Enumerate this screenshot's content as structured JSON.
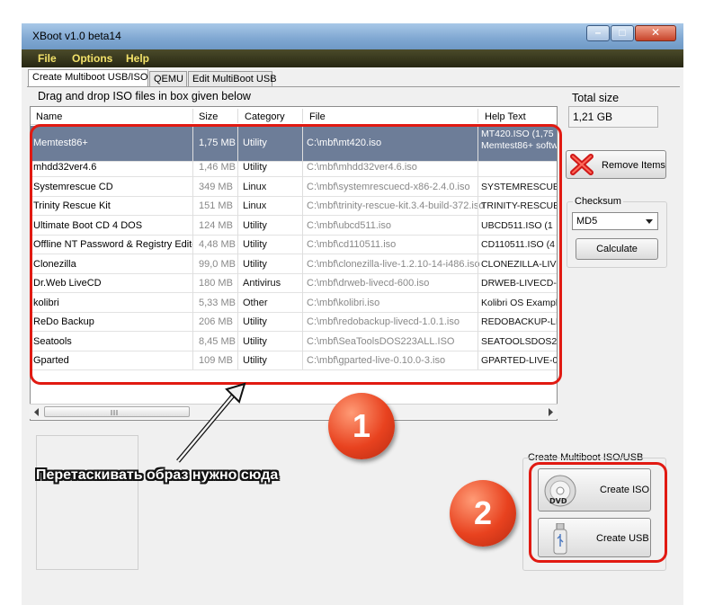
{
  "window": {
    "title": "XBoot v1.0 beta14"
  },
  "menu": [
    "File",
    "Options",
    "Help"
  ],
  "tabs": [
    "Create Multiboot USB/ISO",
    "QEMU",
    "Edit MultiBoot USB"
  ],
  "dragdrop_label": "Drag and drop ISO files in box given below",
  "list": {
    "columns": [
      "Name",
      "Size",
      "Category",
      "File",
      "Help Text"
    ],
    "rows": [
      {
        "name": "Memtest86+",
        "size": "1,75 MB",
        "category": "Utility",
        "file": "C:\\mbf\\mt420.iso",
        "help": "MT420.ISO (1,75",
        "help2": "Memtest86+ softw",
        "selected": true
      },
      {
        "name": "mhdd32ver4.6",
        "size": "1,46 MB",
        "category": "Utility",
        "file": "C:\\mbf\\mhdd32ver4.6.iso",
        "help": ""
      },
      {
        "name": "Systemrescue CD",
        "size": "349 MB",
        "category": "Linux",
        "file": "C:\\mbf\\systemrescuecd-x86-2.4.0.iso",
        "help": "SYSTEMRESCUE"
      },
      {
        "name": "Trinity Rescue Kit",
        "size": "151 MB",
        "category": "Linux",
        "file": "C:\\mbf\\trinity-rescue-kit.3.4-build-372.iso",
        "help": "TRINITY-RESCUE"
      },
      {
        "name": "Ultimate Boot CD 4 DOS",
        "size": "124 MB",
        "category": "Utility",
        "file": "C:\\mbf\\ubcd511.iso",
        "help": "UBCD511.ISO (1"
      },
      {
        "name": "Offline NT Password & Registry Editor",
        "size": "4,48 MB",
        "category": "Utility",
        "file": "C:\\mbf\\cd110511.iso",
        "help": "CD110511.ISO (4"
      },
      {
        "name": "Clonezilla",
        "size": "99,0 MB",
        "category": "Utility",
        "file": "C:\\mbf\\clonezilla-live-1.2.10-14-i486.iso",
        "help": "CLONEZILLA-LIVE"
      },
      {
        "name": "Dr.Web LiveCD",
        "size": "180 MB",
        "category": "Antivirus",
        "file": "C:\\mbf\\drweb-livecd-600.iso",
        "help": "DRWEB-LIVECD-6"
      },
      {
        "name": "kolibri",
        "size": "5,33 MB",
        "category": "Other",
        "file": "C:\\mbf\\kolibri.iso",
        "help": "Kolibri OS Example"
      },
      {
        "name": "ReDo Backup",
        "size": "206 MB",
        "category": "Utility",
        "file": "C:\\mbf\\redobackup-livecd-1.0.1.iso",
        "help": "REDOBACKUP-LI"
      },
      {
        "name": "Seatools",
        "size": "8,45 MB",
        "category": "Utility",
        "file": "C:\\mbf\\SeaToolsDOS223ALL.ISO",
        "help": "SEATOOLSDOS2"
      },
      {
        "name": "Gparted",
        "size": "109 MB",
        "category": "Utility",
        "file": "C:\\mbf\\gparted-live-0.10.0-3.iso",
        "help": "GPARTED-LIVE-0"
      }
    ]
  },
  "right_panel": {
    "total_size_label": "Total size",
    "total_size_value": "1,21 GB",
    "remove_label": "Remove Items",
    "checksum_label": "Checksum",
    "checksum_value": "MD5",
    "calculate_label": "Calculate"
  },
  "create": {
    "group_label": "Create Multiboot ISO/USB",
    "iso_label": "Create ISO",
    "usb_label": "Create USB"
  },
  "annotations": {
    "badge1": "1",
    "badge2": "2",
    "caption": "Перетаскивать образ нужно сюда"
  },
  "colors": {
    "annotation_red": "#e11a12",
    "selection": "#6d7d98",
    "menubar": "#262612",
    "menu_text": "#f3e26a"
  },
  "icons": [
    "remove-x-icon",
    "dvd-icon",
    "usb-stick-icon",
    "dropdown-arrow-icon",
    "scroll-left-icon",
    "scroll-right-icon",
    "scroll-thumb-grip-icon",
    "minimize-icon",
    "maximize-icon",
    "close-icon"
  ]
}
